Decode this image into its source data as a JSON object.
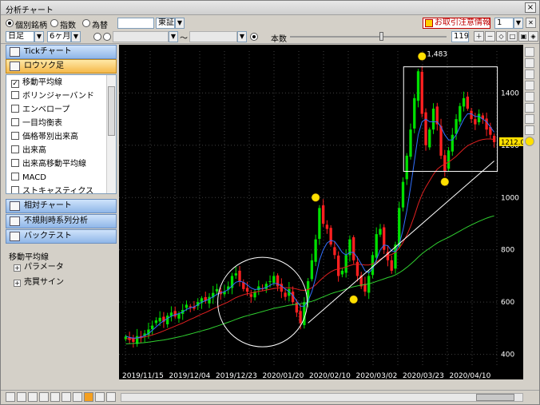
{
  "window": {
    "title": "分析チャート",
    "close": "×"
  },
  "toolbar1": {
    "radio_stock": "個別銘柄",
    "radio_index": "指数",
    "radio_fx": "為替",
    "code_value": "",
    "market_value": "東証",
    "notice_label": "お取引注意情報",
    "window_count": "1"
  },
  "toolbar2": {
    "period_value": "日足",
    "range_value": "6ヶ月",
    "date_from": "",
    "date_to": "",
    "tilde": "～",
    "bars_label": "本数",
    "bars_value": "119"
  },
  "sidebar": {
    "tick_chart": "Tickチャート",
    "candle": "ロウソク足",
    "indicators": [
      {
        "label": "移動平均線",
        "checked": true
      },
      {
        "label": "ボリンジャーバンド",
        "checked": false
      },
      {
        "label": "エンベロープ",
        "checked": false
      },
      {
        "label": "一目均衡表",
        "checked": false
      },
      {
        "label": "価格帯別出来高",
        "checked": false
      },
      {
        "label": "出来高",
        "checked": false
      },
      {
        "label": "出来高移動平均線",
        "checked": false
      },
      {
        "label": "MACD",
        "checked": false
      },
      {
        "label": "ストキャスティクス",
        "checked": false
      }
    ],
    "relative_chart": "相対チャート",
    "irregular": "不規則時系列分析",
    "backtest": "バックテスト",
    "tree_header": "移動平均線",
    "tree_param": "パラメータ",
    "tree_signal": "売買サイン"
  },
  "chart_data": {
    "type": "candlestick",
    "x_tick_labels": [
      "2019/11/15",
      "2019/12/04",
      "2019/12/23",
      "2020/01/20",
      "2020/02/10",
      "2020/03/02",
      "2020/03/23",
      "2020/04/10"
    ],
    "y_tick_labels": [
      400,
      600,
      800,
      1000,
      1200,
      1400
    ],
    "ylim": [
      350,
      1560
    ],
    "last_price_label": "1212.0",
    "peak_label": "1,483",
    "close": [
      468,
      455,
      448,
      470,
      462,
      480,
      495,
      510,
      530,
      540,
      525,
      548,
      560,
      545,
      555,
      570,
      590,
      580,
      575,
      600,
      615,
      605,
      620,
      635,
      650,
      630,
      640,
      660,
      700,
      710,
      680,
      650,
      640,
      620,
      640,
      660,
      650,
      670,
      680,
      700,
      660,
      640,
      620,
      650,
      600,
      560,
      520,
      600,
      680,
      760,
      840,
      960,
      900,
      880,
      820,
      780,
      700,
      720,
      780,
      840,
      760,
      700,
      660,
      640,
      700,
      780,
      860,
      880,
      800,
      760,
      720,
      820,
      960,
      1060,
      1160,
      1260,
      1380,
      1483,
      1320,
      1200,
      1260,
      1340,
      1280,
      1160,
      1100,
      1180,
      1240,
      1300,
      1350,
      1380,
      1340,
      1300,
      1280,
      1320,
      1300,
      1260,
      1240,
      1212
    ],
    "ma_short": [
      470,
      465,
      462,
      463,
      466,
      472,
      480,
      492,
      505,
      518,
      528,
      538,
      546,
      552,
      556,
      562,
      572,
      578,
      582,
      590,
      600,
      605,
      612,
      620,
      630,
      635,
      640,
      648,
      662,
      676,
      680,
      676,
      666,
      654,
      648,
      650,
      652,
      656,
      664,
      672,
      670,
      662,
      650,
      640,
      626,
      604,
      584,
      584,
      604,
      640,
      692,
      760,
      800,
      826,
      836,
      832,
      812,
      790,
      780,
      790,
      790,
      770,
      746,
      720,
      712,
      728,
      762,
      800,
      818,
      816,
      796,
      792,
      820,
      876,
      950,
      1040,
      1140,
      1240,
      1290,
      1300,
      1290,
      1290,
      1290,
      1270,
      1240,
      1220,
      1220,
      1240,
      1270,
      1300,
      1320,
      1320,
      1310,
      1310,
      1300,
      1290,
      1270,
      1250
    ],
    "ma_mid": [
      460,
      460,
      461,
      462,
      464,
      467,
      470,
      474,
      479,
      484,
      490,
      496,
      502,
      508,
      514,
      520,
      527,
      534,
      540,
      547,
      554,
      560,
      567,
      574,
      581,
      588,
      594,
      601,
      609,
      617,
      623,
      628,
      632,
      635,
      638,
      641,
      643,
      646,
      649,
      652,
      654,
      655,
      655,
      655,
      653,
      650,
      646,
      645,
      648,
      655,
      666,
      681,
      694,
      706,
      716,
      723,
      727,
      730,
      734,
      740,
      744,
      745,
      744,
      742,
      742,
      746,
      754,
      764,
      772,
      778,
      782,
      790,
      806,
      828,
      856,
      890,
      930,
      975,
      1012,
      1040,
      1064,
      1088,
      1108,
      1120,
      1128,
      1136,
      1146,
      1158,
      1172,
      1186,
      1198,
      1206,
      1212,
      1218,
      1222,
      1224,
      1224,
      1222
    ],
    "ma_long": [
      440,
      441,
      442,
      443,
      444,
      445,
      447,
      449,
      451,
      453,
      455,
      458,
      461,
      464,
      467,
      470,
      474,
      478,
      482,
      486,
      490,
      494,
      498,
      503,
      508,
      513,
      518,
      523,
      528,
      534,
      539,
      544,
      548,
      552,
      556,
      560,
      564,
      568,
      572,
      576,
      579,
      582,
      585,
      588,
      590,
      592,
      594,
      596,
      599,
      603,
      608,
      614,
      620,
      626,
      632,
      637,
      641,
      645,
      650,
      655,
      659,
      662,
      665,
      667,
      670,
      674,
      679,
      684,
      689,
      694,
      698,
      704,
      712,
      722,
      733,
      745,
      758,
      772,
      785,
      796,
      806,
      816,
      826,
      834,
      841,
      848,
      856,
      864,
      872,
      880,
      888,
      895,
      902,
      909,
      915,
      921,
      926,
      930
    ],
    "grid": true
  },
  "colors": {
    "up": "#00e000",
    "down": "#ff2020",
    "ma_short": "#3070ff",
    "ma_mid": "#e02020",
    "ma_long": "#30d030",
    "annotation": "#ffffff",
    "background": "#000000"
  }
}
